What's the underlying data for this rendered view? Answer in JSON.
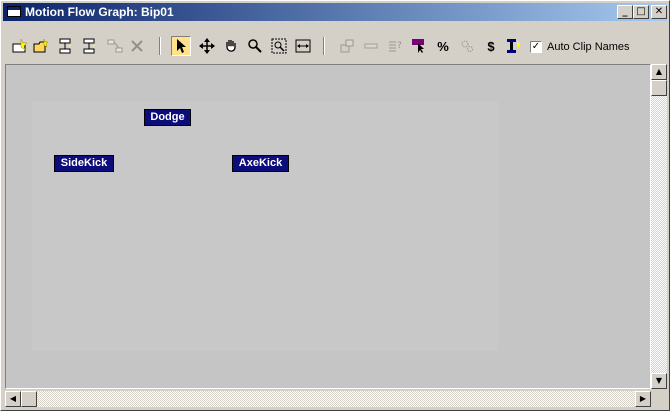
{
  "window": {
    "title": "Motion Flow Graph: Bip01"
  },
  "title_buttons": {
    "minimize": "_",
    "maximize": "□",
    "close": "✕"
  },
  "toolbar": {
    "icons": [
      "create-clip-icon",
      "open-clip-icon",
      "create-transition-icon",
      "delete-transition-icon",
      "create-random-motion-icon",
      "delete-icon",
      "select-arrow-icon",
      "move-icon",
      "pan-hand-icon",
      "zoom-icon",
      "zoom-region-icon",
      "extents-icon",
      "show-scripts-icon",
      "disabled-icon",
      "disabled-2-icon",
      "select-random-start-clip-icon",
      "percent-icon",
      "optimize-icon",
      "dollar-icon",
      "bar-icon"
    ],
    "auto_clip_names_label": "Auto Clip Names",
    "auto_clip_names_checked": true,
    "accent_color": "#ffe28a"
  },
  "nodes": [
    {
      "label": "Dodge"
    },
    {
      "label": "SideKick"
    },
    {
      "label": "AxeKick"
    }
  ],
  "colors": {
    "node_bg": "#0c0c7a",
    "canvas_bg": "#c5c5c5",
    "title_start": "#0a246a"
  }
}
